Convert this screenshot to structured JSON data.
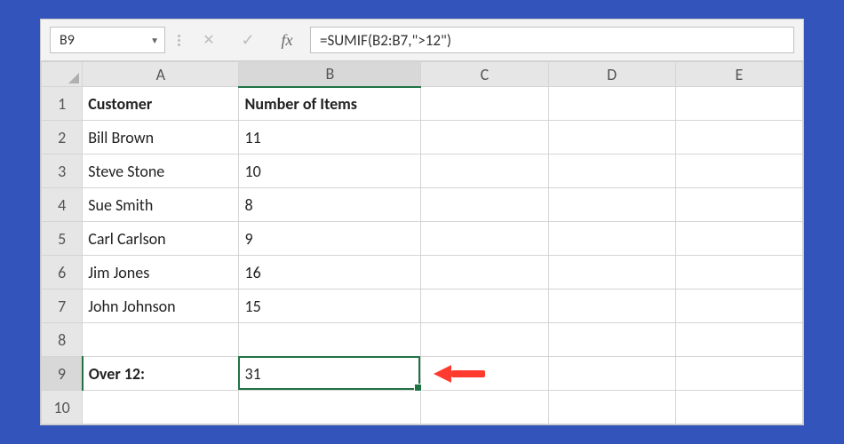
{
  "nameBox": "B9",
  "formula": "=SUMIF(B2:B7,\">12\")",
  "fxLabel": "fx",
  "columns": [
    "A",
    "B",
    "C",
    "D",
    "E"
  ],
  "rows": [
    {
      "n": "1",
      "a": "Customer",
      "b": "Number of Items",
      "aBold": true,
      "bBold": true
    },
    {
      "n": "2",
      "a": "Bill Brown",
      "b": "11"
    },
    {
      "n": "3",
      "a": "Steve Stone",
      "b": "10"
    },
    {
      "n": "4",
      "a": "Sue Smith",
      "b": "8"
    },
    {
      "n": "5",
      "a": "Carl Carlson",
      "b": "9"
    },
    {
      "n": "6",
      "a": "Jim Jones",
      "b": "16"
    },
    {
      "n": "7",
      "a": "John Johnson",
      "b": "15"
    },
    {
      "n": "8",
      "a": "",
      "b": ""
    },
    {
      "n": "9",
      "a": "Over 12:",
      "b": "31",
      "aBold": true,
      "active": true
    },
    {
      "n": "10",
      "a": "",
      "b": ""
    }
  ],
  "activeCell": {
    "row": 9,
    "col": "B",
    "value": "31"
  }
}
